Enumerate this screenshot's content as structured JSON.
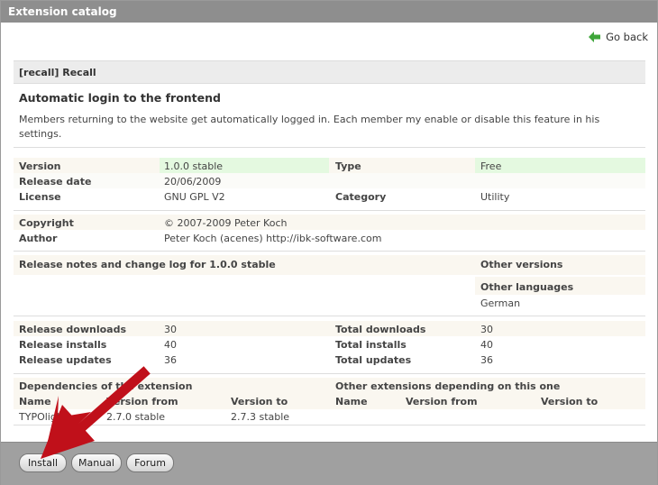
{
  "window": {
    "title": "Extension catalog"
  },
  "nav": {
    "go_back": "Go back"
  },
  "extension": {
    "header": "[recall] Recall",
    "title": "Automatic login to the frontend",
    "description": "Members returning to the website get automatically logged in. Each member my enable or disable this feature in his settings."
  },
  "meta": {
    "version_label": "Version",
    "version_value": "1.0.0 stable",
    "type_label": "Type",
    "type_value": "Free",
    "release_date_label": "Release date",
    "release_date_value": "20/06/2009",
    "license_label": "License",
    "license_value": "GNU GPL V2",
    "category_label": "Category",
    "category_value": "Utility"
  },
  "credits": {
    "copyright_label": "Copyright",
    "copyright_value": "© 2007-2009 Peter Koch",
    "author_label": "Author",
    "author_value": "Peter Koch (acenes) http://ibk-software.com"
  },
  "notes": {
    "release_notes_label": "Release notes and change log for 1.0.0 stable",
    "other_versions_label": "Other versions",
    "other_languages_label": "Other languages",
    "other_languages_value": "German"
  },
  "stats": {
    "release_downloads_label": "Release downloads",
    "release_downloads_value": "30",
    "total_downloads_label": "Total downloads",
    "total_downloads_value": "30",
    "release_installs_label": "Release installs",
    "release_installs_value": "40",
    "total_installs_label": "Total installs",
    "total_installs_value": "40",
    "release_updates_label": "Release updates",
    "release_updates_value": "36",
    "total_updates_label": "Total updates",
    "total_updates_value": "36"
  },
  "dependencies": {
    "title": "Dependencies of the extension",
    "col_name": "Name",
    "col_version_from": "Version from",
    "col_version_to": "Version to",
    "rows": [
      {
        "name": "TYPOlight",
        "from": "2.7.0 stable",
        "to": "2.7.3 stable"
      }
    ]
  },
  "dependents": {
    "title": "Other extensions depending on this one",
    "col_name": "Name",
    "col_version_from": "Version from",
    "col_version_to": "Version to"
  },
  "buttons": {
    "install": "Install",
    "manual": "Manual",
    "forum": "Forum"
  },
  "colors": {
    "titlebar": "#8e8e8e",
    "highlight": "#e4f9e0",
    "annotation_arrow": "#c0101a"
  },
  "icons": {
    "go_back": "green-left-arrow-icon"
  }
}
